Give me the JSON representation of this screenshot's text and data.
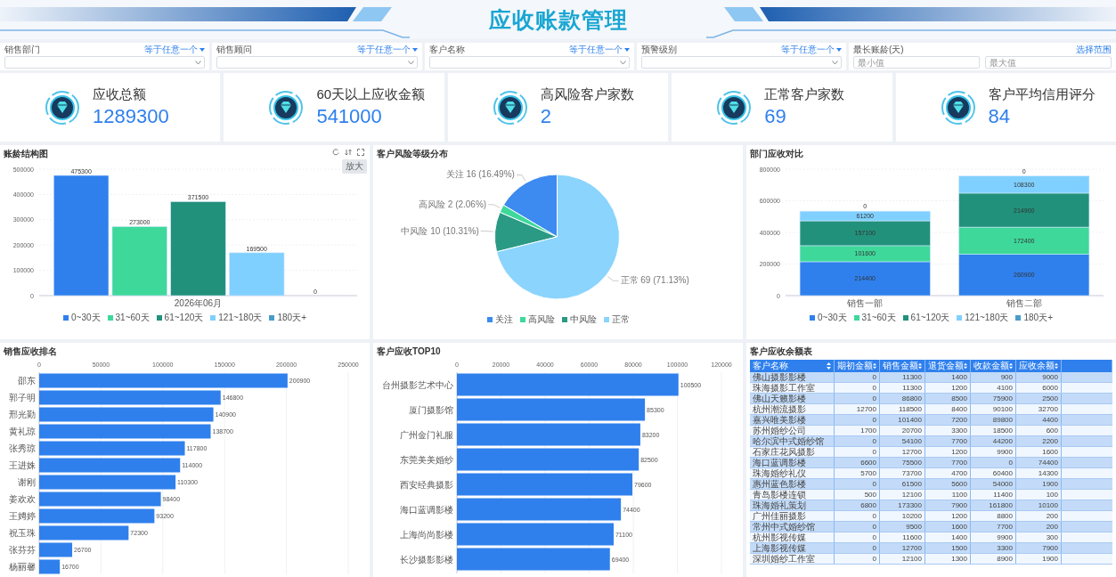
{
  "header": {
    "title": "应收账款管理"
  },
  "filters": [
    {
      "label": "销售部门",
      "operator": "等于任意一个",
      "kind": "select"
    },
    {
      "label": "销售顾问",
      "operator": "等于任意一个",
      "kind": "select"
    },
    {
      "label": "客户名称",
      "operator": "等于任意一个",
      "kind": "select"
    },
    {
      "label": "预警级别",
      "operator": "等于任意一个",
      "kind": "select"
    },
    {
      "label": "最长账龄(天)",
      "operator": "选择范围",
      "kind": "range",
      "min_placeholder": "最小值",
      "max_placeholder": "最大值"
    }
  ],
  "kpis": [
    {
      "label": "应收总额",
      "value": "1289300"
    },
    {
      "label": "60天以上应收金额",
      "value": "541000"
    },
    {
      "label": "高风险客户家数",
      "value": "2"
    },
    {
      "label": "正常客户家数",
      "value": "69"
    },
    {
      "label": "客户平均信用评分",
      "value": "84"
    }
  ],
  "aging_chart": {
    "title": "账龄结构图",
    "tooltip": "放大",
    "chart_data": {
      "type": "bar",
      "grid": true,
      "categories": [
        "2026年06月"
      ],
      "ylim": [
        0,
        500000
      ],
      "yticks": [
        0,
        100000,
        200000,
        300000,
        400000,
        500000
      ],
      "value_labels": [
        [
          "475300"
        ],
        [
          "273000"
        ],
        [
          "371500"
        ],
        [
          "169500"
        ],
        [
          "0"
        ]
      ],
      "series": [
        {
          "name": "0~30天",
          "color": "#2f80ed",
          "values": [
            475300
          ]
        },
        {
          "name": "31~60天",
          "color": "#3ed89b",
          "values": [
            273000
          ]
        },
        {
          "name": "61~120天",
          "color": "#22917b",
          "values": [
            371500
          ]
        },
        {
          "name": "121~180天",
          "color": "#80d0ff",
          "values": [
            169500
          ]
        },
        {
          "name": "180天+",
          "color": "#4a9cc9",
          "values": [
            0
          ]
        }
      ]
    }
  },
  "risk_chart": {
    "title": "客户风险等级分布",
    "slices": [
      {
        "color": "#3d8af0",
        "callout": "关注 16 (16.49%)"
      },
      {
        "color": "#3ed89b",
        "callout": "高风险 2 (2.06%)"
      },
      {
        "color": "#2b9a84",
        "callout": "中风险 10 (10.31%)"
      },
      {
        "color": "#8ad4fd",
        "callout": "正常 69 (71.13%)"
      }
    ],
    "chart_data": {
      "type": "pie",
      "categories": [
        "关注",
        "高风险",
        "中风险",
        "正常"
      ],
      "values": [
        16.49,
        2.06,
        10.31,
        71.13
      ]
    }
  },
  "dept_chart": {
    "title": "部门应收对比",
    "chart_data": {
      "type": "bar",
      "grid": true,
      "stacked": true,
      "categories": [
        "销售一部",
        "销售二部"
      ],
      "ylim": [
        0,
        800000
      ],
      "yticks": [
        0,
        200000,
        400000,
        600000,
        800000
      ],
      "value_labels": [
        [
          "214400",
          "260900"
        ],
        [
          "101600",
          "172400"
        ],
        [
          "157100",
          "214900"
        ],
        [
          "61200",
          "108300"
        ],
        [
          "0",
          "0"
        ]
      ],
      "series": [
        {
          "name": "0~30天",
          "color": "#2f80ed",
          "values": [
            214400,
            260900
          ]
        },
        {
          "name": "31~60天",
          "color": "#3ed89b",
          "values": [
            101600,
            172400
          ]
        },
        {
          "name": "61~120天",
          "color": "#22917b",
          "values": [
            157100,
            214900
          ]
        },
        {
          "name": "121~180天",
          "color": "#80d0ff",
          "values": [
            61200,
            108300
          ]
        },
        {
          "name": "180天+",
          "color": "#4a9cc9",
          "values": [
            0,
            0
          ]
        }
      ]
    }
  },
  "sales_chart": {
    "title": "销售应收排名",
    "chart_data": {
      "type": "bar",
      "grid": true,
      "orientation": "horizontal",
      "xlim": [
        0,
        250000
      ],
      "xticks": [
        0,
        50000,
        100000,
        150000,
        200000,
        250000
      ],
      "data_labels": true,
      "categories": [
        "邵东",
        "郭子明",
        "邢光勤",
        "黄礼琼",
        "张秀琼",
        "王进姝",
        "谢刚",
        "姜欢欢",
        "王娉婷",
        "祝玉珠",
        "张芬芬",
        "杨丽馨"
      ],
      "values": [
        200900,
        146800,
        140900,
        138700,
        117800,
        114000,
        110300,
        98400,
        93200,
        72300,
        26700,
        16700
      ]
    }
  },
  "top_chart": {
    "title": "客户应收TOP10",
    "chart_data": {
      "type": "bar",
      "grid": true,
      "orientation": "horizontal",
      "xlim": [
        0,
        120000
      ],
      "xticks": [
        0,
        20000,
        40000,
        60000,
        80000,
        100000,
        120000
      ],
      "data_labels": true,
      "categories": [
        "台州摄影艺术中心",
        "厦门摄影馆",
        "广州金门礼服",
        "东莞美美婚纱",
        "西安经典摄影",
        "海口蓝调影楼",
        "上海尚尚影楼",
        "长沙摄影影楼"
      ],
      "values": [
        100500,
        85300,
        83200,
        82500,
        79600,
        74400,
        71100,
        69400
      ]
    }
  },
  "balance_table": {
    "title": "客户应收余额表",
    "columns": [
      "客户名称",
      "期初金额",
      "销售金额",
      "退货金额",
      "收款金额",
      "应收余额"
    ],
    "rows": [
      [
        "佛山摄影影楼",
        "0",
        "11300",
        "1400",
        "900",
        "9000"
      ],
      [
        "珠海摄影工作室",
        "0",
        "11300",
        "1200",
        "4100",
        "6000"
      ],
      [
        "佛山天籁影楼",
        "0",
        "86800",
        "8500",
        "75900",
        "2500"
      ],
      [
        "杭州潮流摄影",
        "12700",
        "118500",
        "8400",
        "90100",
        "32700"
      ],
      [
        "嘉兴唯美影楼",
        "0",
        "101400",
        "7200",
        "89800",
        "4400"
      ],
      [
        "苏州婚纱公司",
        "1700",
        "20700",
        "3300",
        "18500",
        "600"
      ],
      [
        "哈尔滨中式婚纱馆",
        "0",
        "54100",
        "7700",
        "44200",
        "2200"
      ],
      [
        "石家庄花风摄影",
        "0",
        "12700",
        "1200",
        "9900",
        "1600"
      ],
      [
        "海口蓝调影楼",
        "6600",
        "75500",
        "7700",
        "0",
        "74400"
      ],
      [
        "珠海婚纱礼仪",
        "5700",
        "73700",
        "4700",
        "60400",
        "14300"
      ],
      [
        "惠州蓝色影楼",
        "0",
        "61500",
        "5600",
        "54000",
        "1900"
      ],
      [
        "青岛影楼连锁",
        "500",
        "12100",
        "1100",
        "11400",
        "100"
      ],
      [
        "珠海婚礼策划",
        "6800",
        "173300",
        "7900",
        "161800",
        "10100"
      ],
      [
        "广州佳丽摄影",
        "0",
        "10200",
        "1200",
        "8800",
        "200"
      ],
      [
        "常州中式婚纱馆",
        "0",
        "9500",
        "1600",
        "7700",
        "200"
      ],
      [
        "杭州影视传媒",
        "0",
        "11600",
        "1400",
        "9900",
        "300"
      ],
      [
        "上海影视传媒",
        "0",
        "12700",
        "1500",
        "3300",
        "7900"
      ],
      [
        "深圳婚纱工作室",
        "0",
        "12100",
        "1300",
        "8900",
        "1900"
      ]
    ]
  }
}
